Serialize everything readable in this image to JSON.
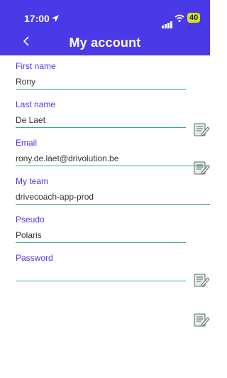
{
  "status_bar": {
    "time": "17:00",
    "battery": "40"
  },
  "header": {
    "title": "My account"
  },
  "fields": [
    {
      "label": "First name",
      "value": "Rony",
      "editable": true
    },
    {
      "label": "Last name",
      "value": "De Laet",
      "editable": true
    },
    {
      "label": "Email",
      "value": "rony.de.laet@drivolution.be",
      "editable": false
    },
    {
      "label": "My team",
      "value": "drivecoach-app-prod",
      "editable": false
    },
    {
      "label": "Pseudo",
      "value": "Polaris",
      "editable": true
    },
    {
      "label": "Password",
      "value": "",
      "editable": true
    }
  ],
  "colors": {
    "header_bg": "#4a39e6",
    "label": "#4a39e6",
    "underline": "#39a87a",
    "battery": "#d5e41a"
  }
}
